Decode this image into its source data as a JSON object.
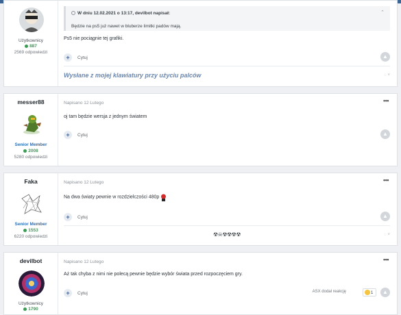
{
  "posts": [
    {
      "author_name": "",
      "group": "Użytkownicy",
      "reputation": "887",
      "posts_count": "2569 odpowiedzi",
      "quote": {
        "header": "W dniu 12.02.2021 o 13:17, devilbot napisał:",
        "body": "Będzie na ps5 już nawet w bluberze limitki padów mają."
      },
      "content": "Ps5 nie pociągnie tej grafiki.",
      "quote_label": "Cytuj",
      "signature": "Wysłane z mojej klawiatury przy użyciu palców"
    },
    {
      "author_name": "messer88",
      "group": "Senior Member",
      "reputation": "2008",
      "posts_count": "5280 odpowiedzi",
      "meta": "Napisano 12 Lutego",
      "content": "oj tam będzie wersja z jednym światem",
      "quote_label": "Cytuj"
    },
    {
      "author_name": "Faka",
      "group": "Senior Member",
      "reputation": "1553",
      "posts_count": "6220 odpowiedzi",
      "meta": "Napisano 12 Lutego",
      "content": "Na dwa światy pewnie w rozdzielczości 480p",
      "quote_label": "Cytuj",
      "signature_emoji": "☢☠☢☢☢☢"
    },
    {
      "author_name": "devilbot",
      "group": "Użytkownicy",
      "reputation": "1790",
      "meta": "Napisano 12 Lutego",
      "content": "Aż tak chyba z nimi nie polecą pewnie będzie wybór świata przed rozpoczęciem gry.",
      "quote_label": "Cytuj",
      "reacted_by": "ASX dodał reakcję",
      "reaction_count": "1"
    }
  ],
  "menu_icon": "ellipsis-icon",
  "colors": {
    "accent": "#3d6594",
    "senior": "#2f6fb3",
    "rep": "#3c9a55",
    "signature": "#6a86ad"
  }
}
